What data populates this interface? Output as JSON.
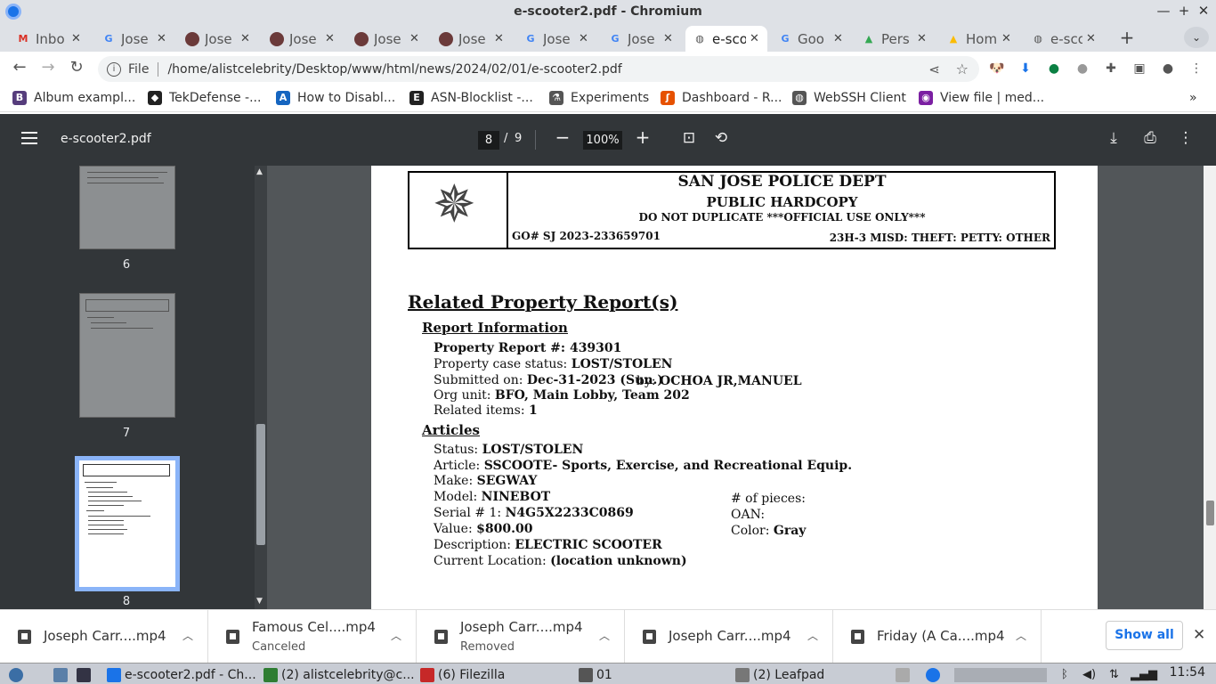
{
  "window": {
    "title": "e-scooter2.pdf - Chromium"
  },
  "tabs": [
    {
      "label": "Inbo",
      "icon": "gmail-icon",
      "icon_color": "#d93025",
      "glyph": "M"
    },
    {
      "label": "Jose",
      "icon": "google-icon",
      "icon_color": "#4285f4",
      "glyph": "G"
    },
    {
      "label": "Jose",
      "icon": "avatar-icon",
      "icon_color": "#6b3a3a",
      "glyph": ""
    },
    {
      "label": "Jose",
      "icon": "avatar-icon",
      "icon_color": "#6b3a3a",
      "glyph": ""
    },
    {
      "label": "Jose",
      "icon": "avatar-icon",
      "icon_color": "#6b3a3a",
      "glyph": ""
    },
    {
      "label": "Jose",
      "icon": "avatar-icon",
      "icon_color": "#6b3a3a",
      "glyph": ""
    },
    {
      "label": "Jose",
      "icon": "google-icon",
      "icon_color": "#4285f4",
      "glyph": "G"
    },
    {
      "label": "Jose",
      "icon": "google-icon",
      "icon_color": "#4285f4",
      "glyph": "G"
    },
    {
      "label": "e-sco",
      "icon": "globe-icon",
      "icon_color": "#555555",
      "glyph": "◍"
    },
    {
      "label": "Goo",
      "icon": "google-icon",
      "icon_color": "#4285f4",
      "glyph": "G"
    },
    {
      "label": "Pers",
      "icon": "drive-icon",
      "icon_color": "#34a853",
      "glyph": "▲"
    },
    {
      "label": "Hom",
      "icon": "drive-icon",
      "icon_color": "#fbbc04",
      "glyph": "▲"
    },
    {
      "label": "e-sco",
      "icon": "globe-icon",
      "icon_color": "#555555",
      "glyph": "◍"
    }
  ],
  "toolbar": {
    "file_label": "File",
    "url": "/home/alistcelebrity/Desktop/www/html/news/2024/02/01/e-scooter2.pdf"
  },
  "bookmarks": [
    {
      "label": "Album exampl...",
      "color": "#563d7c",
      "glyph": "B"
    },
    {
      "label": "TekDefense -...",
      "color": "#222222",
      "glyph": "◆"
    },
    {
      "label": "How to Disabl...",
      "color": "#1565c0",
      "glyph": "A"
    },
    {
      "label": "ASN-Blocklist -...",
      "color": "#222222",
      "glyph": "E"
    },
    {
      "label": "Experiments",
      "color": "#555555",
      "glyph": "⚗"
    },
    {
      "label": "Dashboard - R...",
      "color": "#e65100",
      "glyph": "ʃ"
    },
    {
      "label": "WebSSH Client",
      "color": "#555555",
      "glyph": "◍"
    },
    {
      "label": "View file | med...",
      "color": "#7b1fa2",
      "glyph": "◉"
    }
  ],
  "pdf": {
    "filename": "e-scooter2.pdf",
    "current_page": "8",
    "separator": "/",
    "total_pages": "9",
    "zoom": "100%"
  },
  "thumbnails": [
    {
      "label": "6"
    },
    {
      "label": "7"
    },
    {
      "label": "8"
    }
  ],
  "document": {
    "dept": "SAN JOSE POLICE DEPT",
    "hardcopy": "PUBLIC HARDCOPY",
    "notice": "DO NOT DUPLICATE ***OFFICIAL USE ONLY***",
    "go_number": "GO# SJ 2023-233659701",
    "offense": "23H-3 MISD: THEFT: PETTY: OTHER",
    "section_title": "Related Property Report(s)",
    "report_info_title": "Report Information",
    "report_rows": [
      {
        "label": "Property Report #: ",
        "value": "439301"
      },
      {
        "label": "Property case status: ",
        "value": "LOST/STOLEN"
      },
      {
        "label": "Submitted on: ",
        "value": "Dec-31-2023  (Sun.)"
      },
      {
        "label": "Org unit: ",
        "value": "BFO, Main Lobby, Team 202"
      },
      {
        "label": "Related items: ",
        "value": "1"
      }
    ],
    "submitted_by_label": "by: ",
    "submitted_by": "OCHOA JR,MANUEL",
    "articles_title": "Articles",
    "article_rows": [
      {
        "label": "Status: ",
        "value": "LOST/STOLEN"
      },
      {
        "label": "Article: ",
        "value": "SSCOOTE- Sports, Exercise, and Recreational Equip."
      },
      {
        "label": "Make: ",
        "value": "SEGWAY"
      },
      {
        "label": "Model: ",
        "value": "NINEBOT"
      },
      {
        "label": "Serial # 1: ",
        "value": "N4G5X2233C0869"
      },
      {
        "label": "Value:  ",
        "value": "$800.00"
      },
      {
        "label": "Description: ",
        "value": "ELECTRIC SCOOTER"
      },
      {
        "label": "Current Location: ",
        "value": "(location unknown)"
      }
    ],
    "side_rows": [
      {
        "label": "# of pieces:",
        "value": ""
      },
      {
        "label": "OAN:",
        "value": ""
      },
      {
        "label": "Color: ",
        "value": "Gray"
      }
    ]
  },
  "downloads": [
    {
      "name": "Joseph Carr....mp4",
      "status": ""
    },
    {
      "name": "Famous Cel....mp4",
      "status": "Canceled"
    },
    {
      "name": "Joseph Carr....mp4",
      "status": "Removed"
    },
    {
      "name": "Joseph Carr....mp4",
      "status": ""
    },
    {
      "name": "Friday (A Ca....mp4",
      "status": ""
    }
  ],
  "show_all_label": "Show all",
  "taskbar": {
    "items": [
      {
        "label": "e-scooter2.pdf - Ch...",
        "color": "#1a73e8"
      },
      {
        "label": "(2) alistcelebrity@c...",
        "color": "#2e7d32"
      },
      {
        "label": "(6) Filezilla",
        "color": "#c62828"
      },
      {
        "label": "01",
        "color": "#555555"
      },
      {
        "label": "(2) Leafpad",
        "color": "#777777"
      }
    ],
    "clock": "11:54"
  }
}
